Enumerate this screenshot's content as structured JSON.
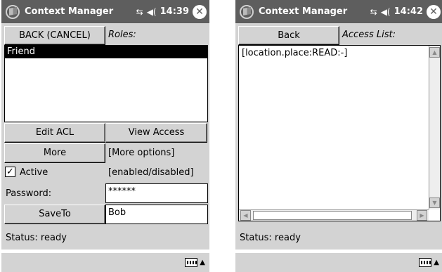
{
  "left": {
    "title": "Context Manager",
    "time": "14:39",
    "back_button": "BACK (CANCEL)",
    "roles_label": "Roles:",
    "roles": [
      "Friend"
    ],
    "edit_acl": "Edit ACL",
    "view_access": "View Access",
    "more": "More",
    "more_options": "[More options]",
    "active_label": "Active",
    "active_checked": "✓",
    "enabled_disabled": "[enabled/disabled]",
    "password_label": "Password:",
    "password_value": "******",
    "save_to": "SaveTo",
    "save_to_value": "Bob",
    "status": "Status: ready"
  },
  "right": {
    "title": "Context Manager",
    "time": "14:42",
    "back_button": "Back",
    "access_list_label": "Access List:",
    "access_entries": [
      "[location.place:READ:-]"
    ],
    "status": "Status: ready"
  },
  "icons": {
    "connectivity": "⇆",
    "volume": "◀(",
    "close": "✕",
    "keyboard_arrow": "▲",
    "scroll_up": "▲",
    "scroll_down": "▼",
    "scroll_left": "◀",
    "scroll_right": "▶"
  }
}
